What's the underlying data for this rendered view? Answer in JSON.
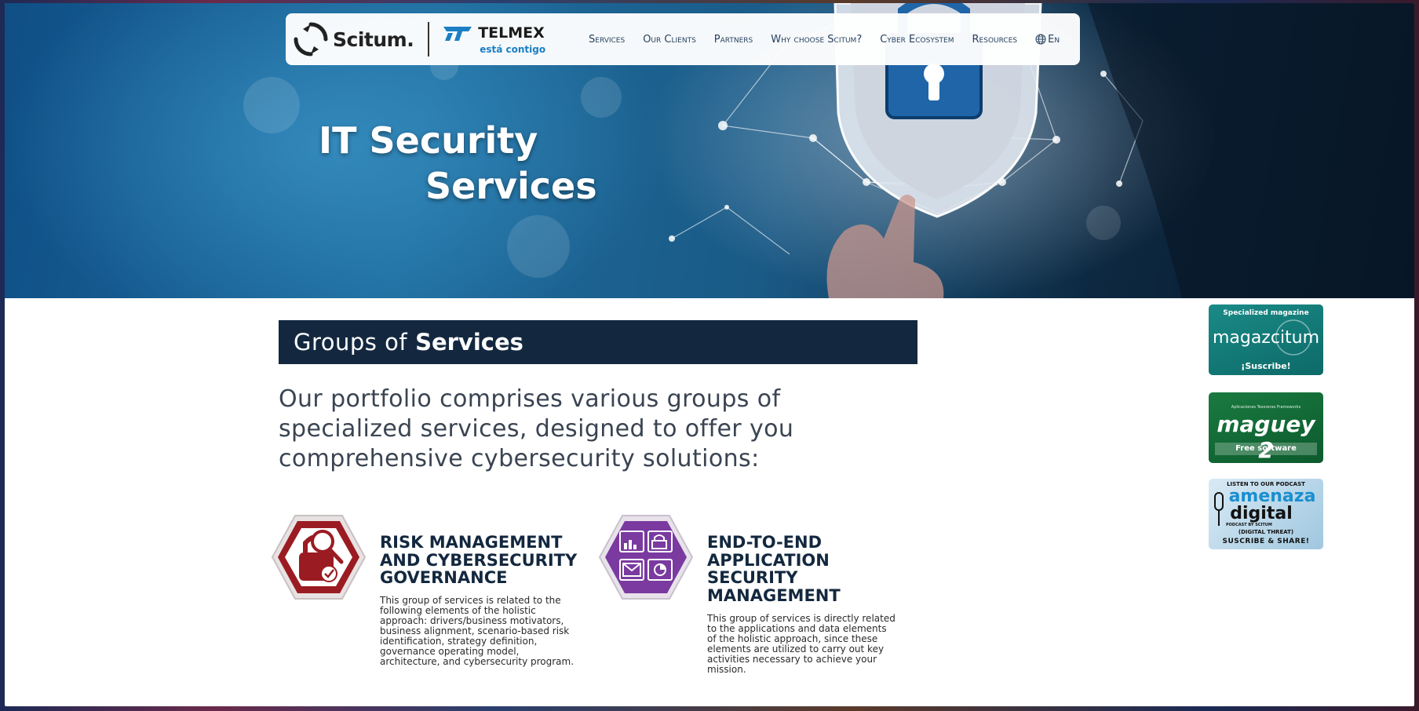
{
  "nav": {
    "brand": "Scitum.",
    "partner": "TELMEX",
    "partner_tagline": "está contigo",
    "links": [
      "Services",
      "Our Clients",
      "Partners",
      "Why choose Scitum?",
      "Cyber Ecosystem",
      "Resources"
    ],
    "language": "En",
    "language_icon": "globe-icon"
  },
  "hero": {
    "title_line1": "IT Security",
    "title_line2": "Services"
  },
  "main": {
    "section_light": "Groups of",
    "section_bold": "Services",
    "intro": "Our portfolio comprises various groups of specialized services, designed to offer you comprehensive cybersecurity solutions:",
    "services": [
      {
        "title": "RISK MANAGEMENT AND CYBERSECURITY GOVERNANCE",
        "title_lines": [
          "RISK MANAGEMENT",
          "AND CYBERSECURITY",
          "GOVERNANCE"
        ],
        "description_lines": [
          "This group of services is related to the",
          "following elements of the holistic",
          "approach: drivers/business motivators,",
          "business alignment, scenario-based risk",
          "identification, strategy definition,",
          "governance operating model,",
          "architecture, and cybersecurity program."
        ],
        "icon": "lock-magnifier-icon",
        "color": "#9a1c22"
      },
      {
        "title": "END-TO-END APPLICATION SECURITY MANAGEMENT",
        "title_lines": [
          "END-TO-END",
          "APPLICATION",
          "SECURITY",
          "MANAGEMENT"
        ],
        "description_lines": [
          "This group of services is directly related",
          "to the applications and data elements",
          "of the holistic approach, since these",
          "elements are utilized to carry out key",
          "activities necessary to achieve your",
          "mission."
        ],
        "icon": "app-grid-icon",
        "color": "#7a3aa0"
      }
    ]
  },
  "sidebar": {
    "banners": [
      {
        "top": "Specialized magazine",
        "main": "magazcitum",
        "bottom": "¡Suscribe!"
      },
      {
        "top": "Aplicaciones Tesoreras Frameworks",
        "main": "maguey 2",
        "bottom": "Free software"
      },
      {
        "top": "LISTEN TO OUR PODCAST",
        "main1": "amenaza",
        "main2": "digital",
        "sub": "PODCAST BY SCITUM",
        "caption": "(DIGITAL THREAT)",
        "bottom": "SUSCRIBE & SHARE!"
      }
    ]
  },
  "colors": {
    "navy": "#13283f",
    "nav_text": "#27415e",
    "risk_red": "#9a1c22",
    "app_purple": "#7a3aa0"
  }
}
